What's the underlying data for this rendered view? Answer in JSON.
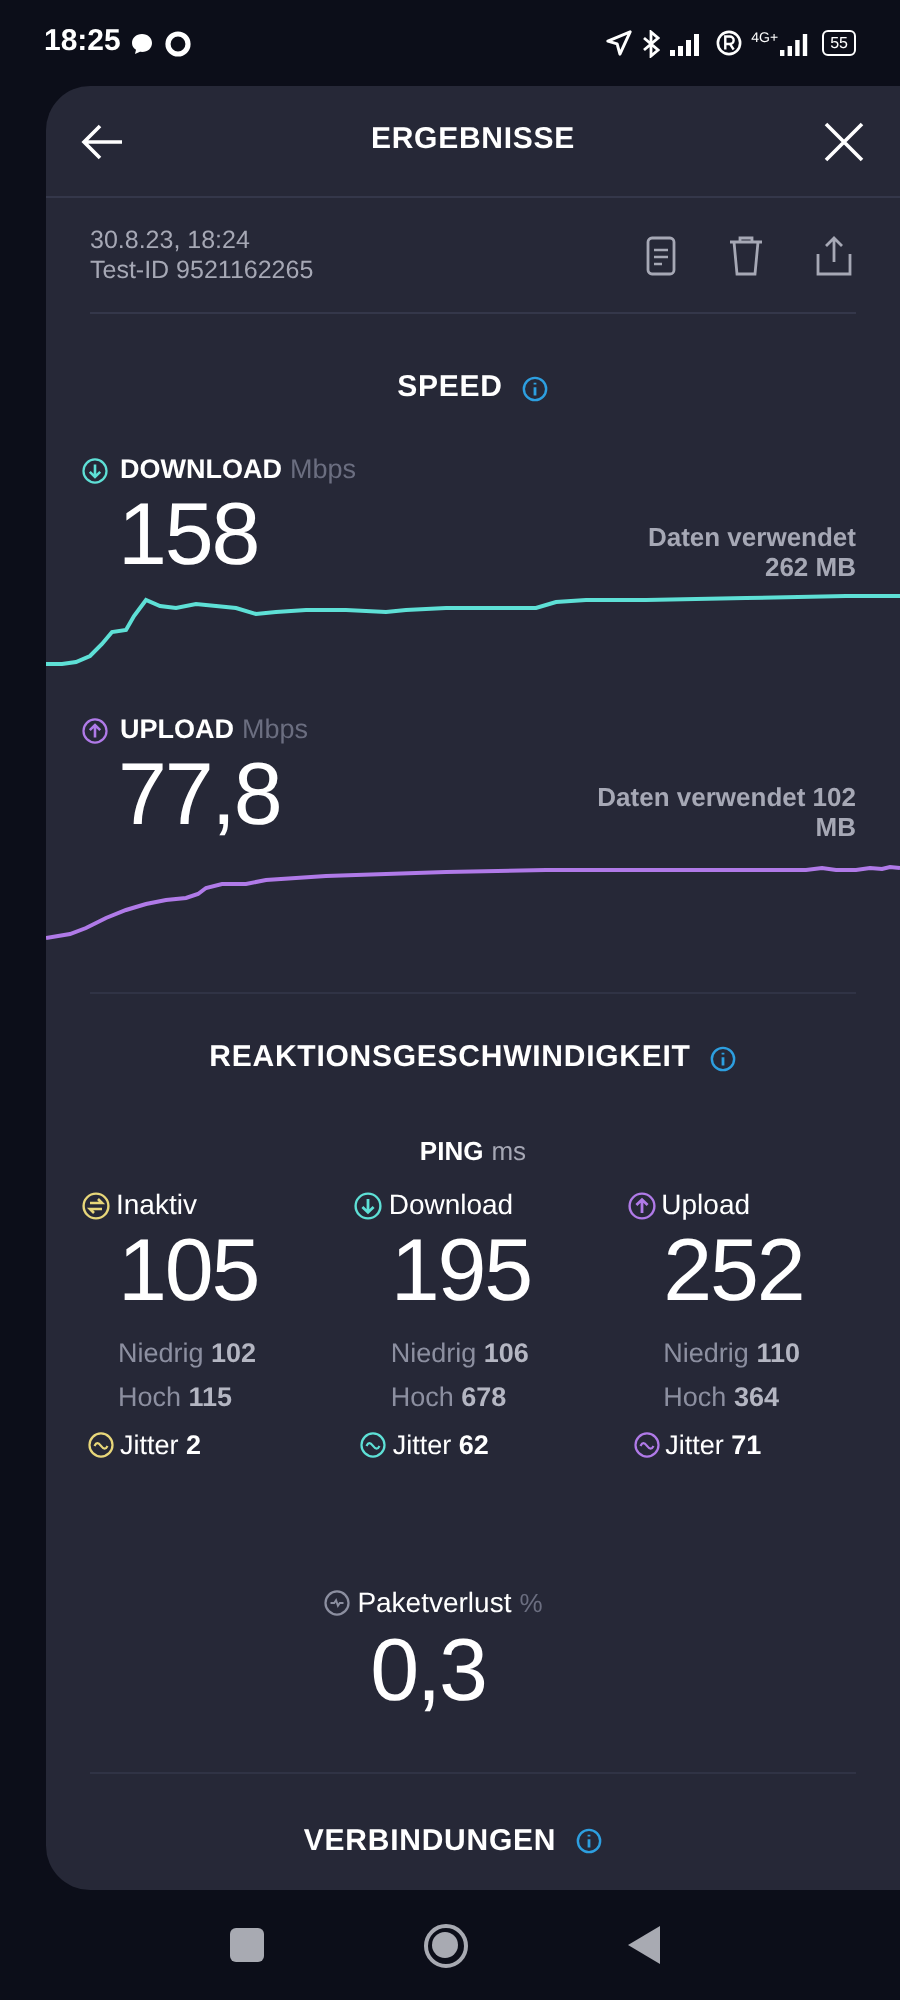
{
  "status_bar": {
    "time": "18:25",
    "network": "4G+",
    "battery": "55"
  },
  "header": {
    "title": "ERGEBNISSE"
  },
  "test": {
    "datetime": "30.8.23, 18:24",
    "test_id": "Test-ID 9521162265"
  },
  "speed": {
    "title": "SPEED",
    "results": [
      {
        "kind": "download",
        "label": "DOWNLOAD",
        "unit": "Mbps",
        "value": "158",
        "data_used": [
          "Daten verwendet",
          "262 MB"
        ],
        "color": "#5ee0d6"
      },
      {
        "kind": "upload",
        "label": "UPLOAD",
        "unit": "Mbps",
        "value": "77,8",
        "data_used": [
          "Daten verwendet 102",
          "MB"
        ],
        "color": "#b07ae8"
      }
    ]
  },
  "reaction": {
    "title": "REAKTIONSGESCHWINDIGKEIT",
    "ping_label": "PING",
    "ping_unit": "ms",
    "columns": [
      {
        "kind": "idle",
        "label": "Inaktiv",
        "value": "105",
        "low": "Niedrig **102**",
        "high": "Hoch **115**",
        "jitter": "Jitter **2**",
        "color": "#e8d77a"
      },
      {
        "kind": "download",
        "label": "Download",
        "value": "195",
        "low": "Niedrig **106**",
        "high": "Hoch **678**",
        "jitter": "Jitter **62**",
        "color": "#5ee0d6"
      },
      {
        "kind": "upload",
        "label": "Upload",
        "value": "252",
        "low": "Niedrig **110**",
        "high": "Hoch **364**",
        "jitter": "Jitter **71**",
        "color": "#b07ae8"
      }
    ]
  },
  "packet_loss": {
    "label": "Paketverlust",
    "unit": "%",
    "value": "0,3"
  },
  "connections": {
    "title": "VERBINDUNGEN"
  }
}
